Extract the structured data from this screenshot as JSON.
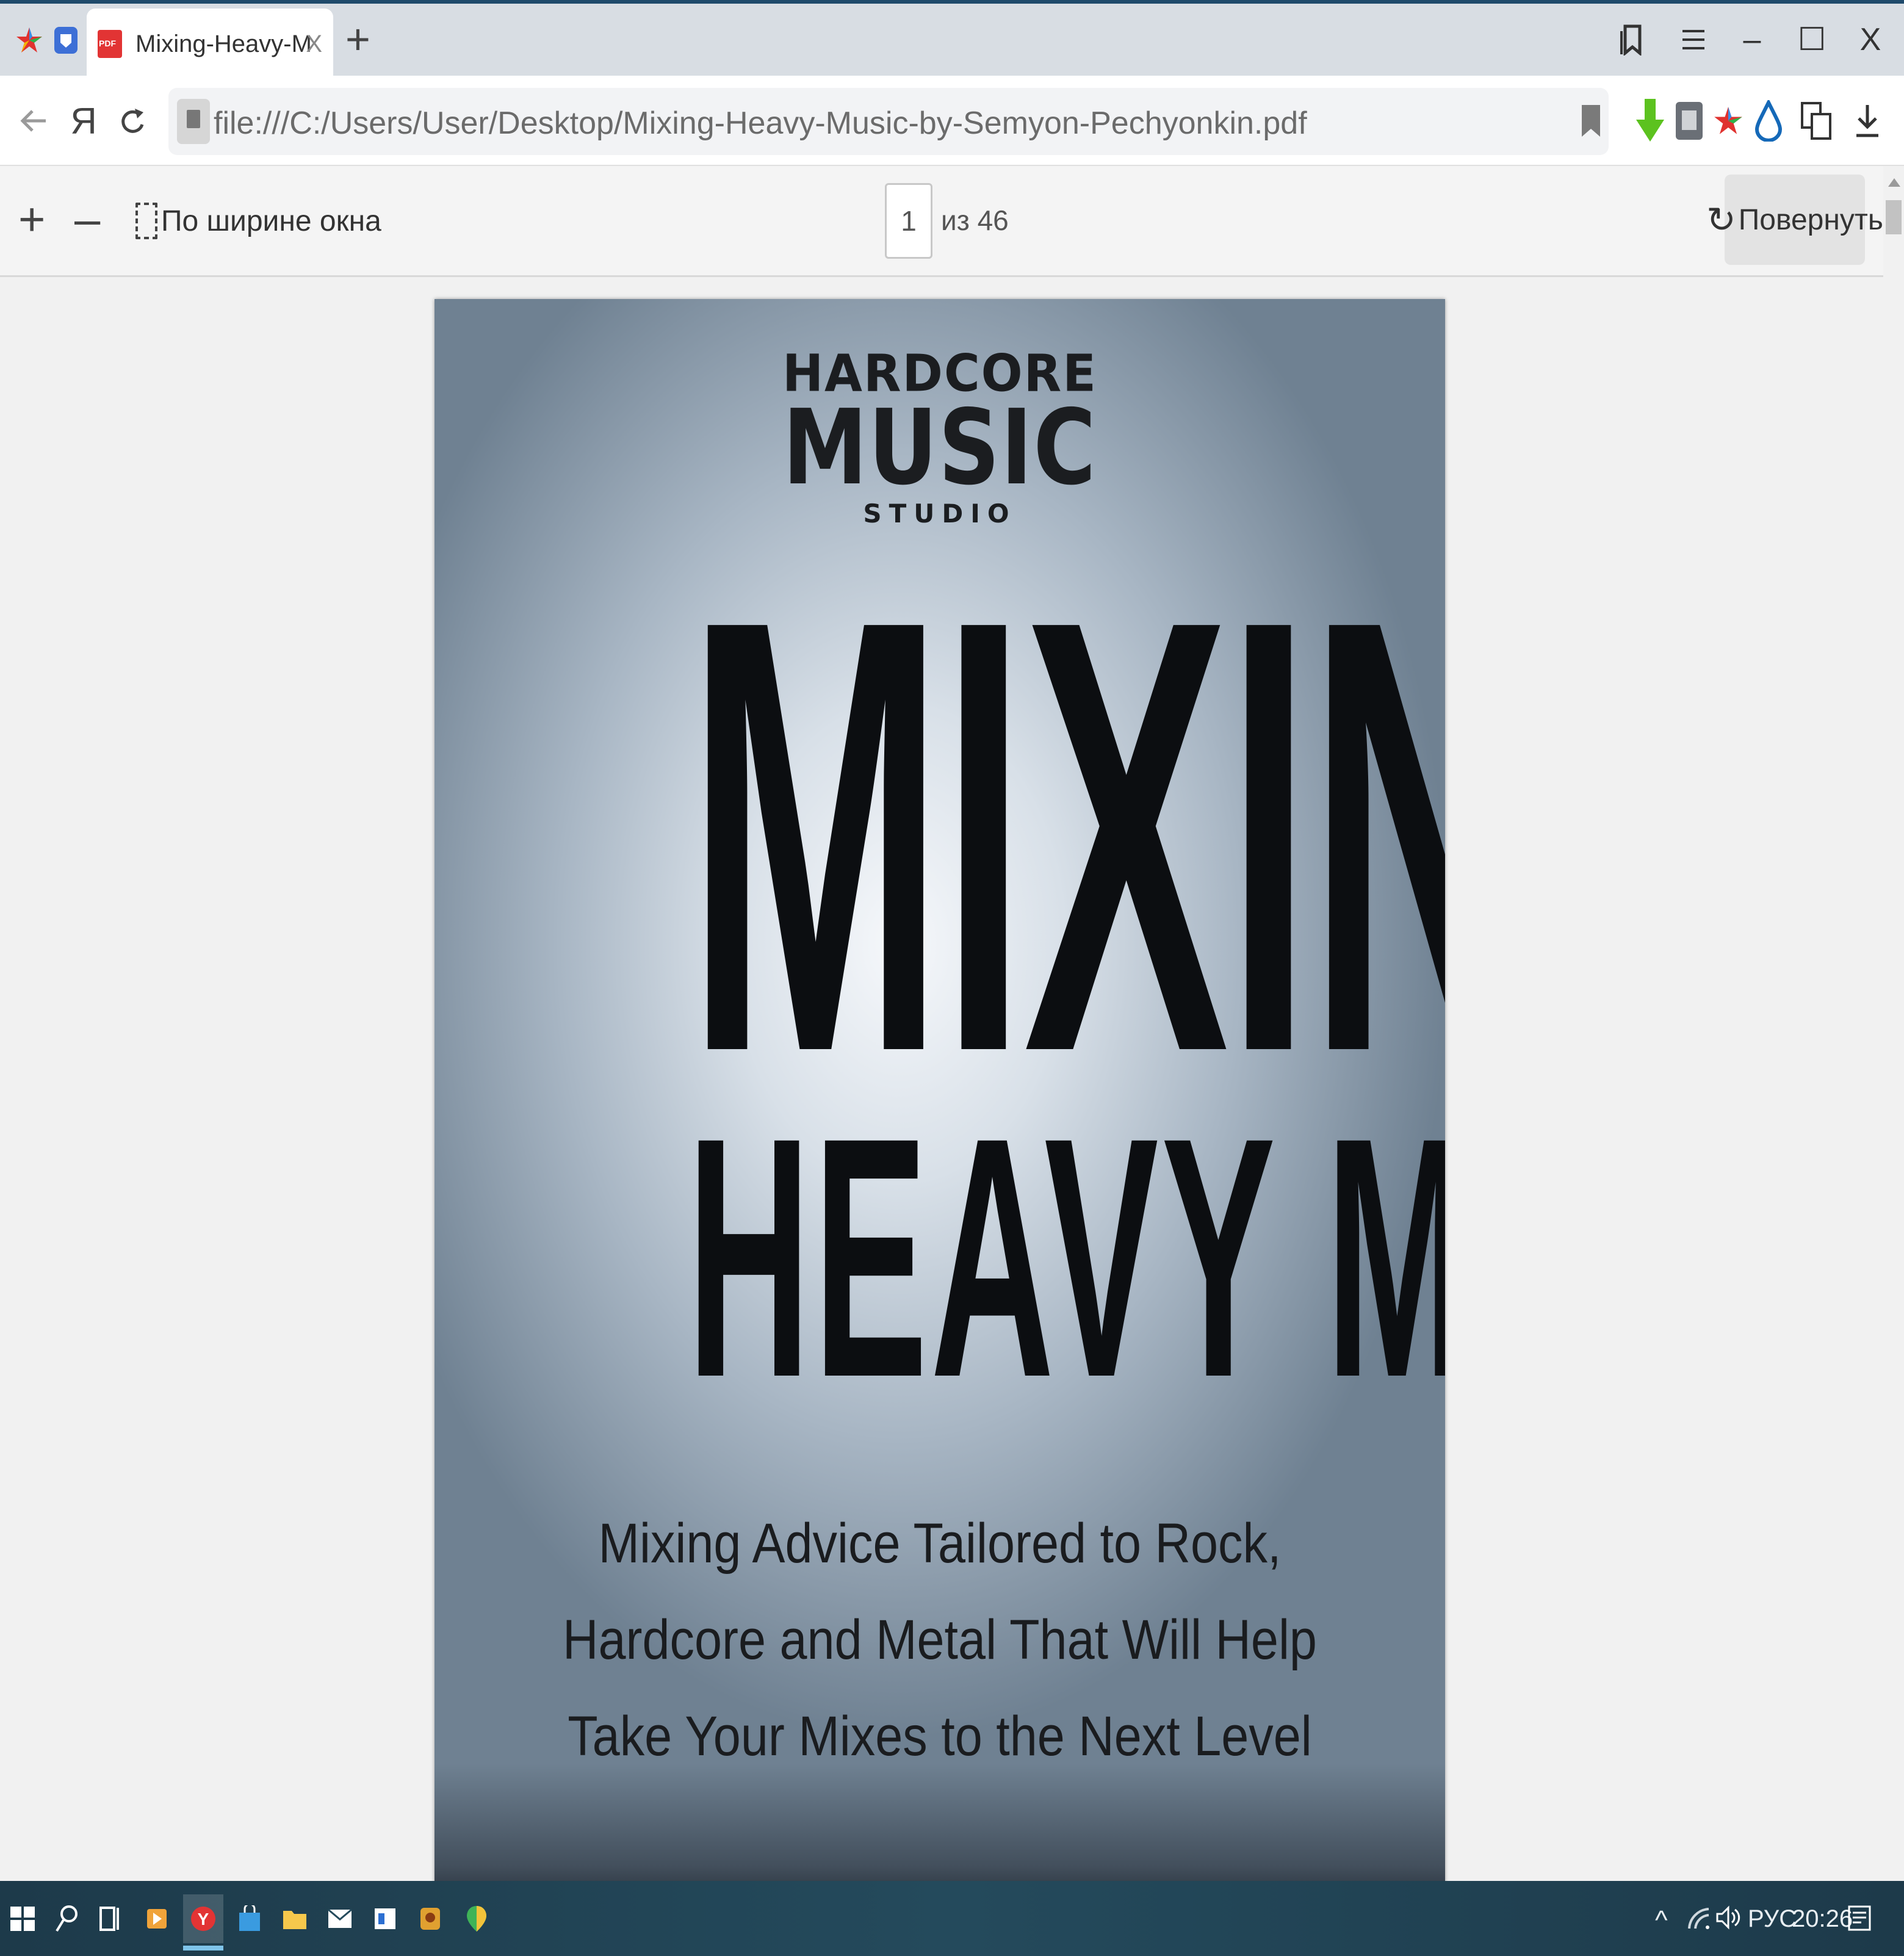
{
  "browser": {
    "tab": {
      "title": "Mixing-Heavy-Music-by-",
      "close_glyph": "X"
    },
    "new_tab_glyph": "+",
    "window_controls": {
      "minimize_glyph": "–",
      "maximize_glyph": "☐",
      "close_glyph": "X"
    },
    "address": {
      "yandex_glyph": "Я",
      "url": "file:///C:/Users/User/Desktop/Mixing-Heavy-Music-by-Semyon-Pechyonkin.pdf"
    }
  },
  "pdf_toolbar": {
    "zoom_in_glyph": "+",
    "zoom_out_glyph": "–",
    "fit_width_label": "По ширине окна",
    "current_page": "1",
    "page_total_label": "из 46",
    "rotate_label": "Повернуть"
  },
  "document": {
    "logo": {
      "line1": "HARDCORE",
      "line2": "MUSIC",
      "line3": "STUDIO"
    },
    "title_line1": "MIXING",
    "title_line2": "HEAVY  MUSIC",
    "subtitle_lines": [
      "Mixing Advice Tailored to Rock,",
      "Hardcore and Metal That Will Help",
      "Take Your Mixes to the Next Level"
    ]
  },
  "taskbar": {
    "tray": {
      "language": "РУС",
      "time": "20:26"
    }
  },
  "colors": {
    "tabstrip_bg": "#d8dde3",
    "accent_download": "#5cc21f",
    "taskbar_bg": "#244a5c",
    "yandex_red": "#e23434"
  },
  "icons": {
    "tabstrip": [
      "colorful-star-icon",
      "shield-tab-icon"
    ],
    "window": [
      "bookmarks-icon",
      "menu-icon"
    ],
    "address_extensions": [
      "green-download-arrow-icon",
      "extension-gray-icon",
      "colorful-star-extension-icon",
      "blue-drop-icon",
      "translate-icon",
      "downloads-icon"
    ],
    "taskbar": [
      "windows-start-icon",
      "search-icon",
      "task-view-icon",
      "media-app-icon",
      "yandex-browser-icon",
      "store-icon",
      "file-explorer-icon",
      "mail-icon",
      "news-app-icon",
      "game-app-icon",
      "maps-app-icon"
    ]
  }
}
